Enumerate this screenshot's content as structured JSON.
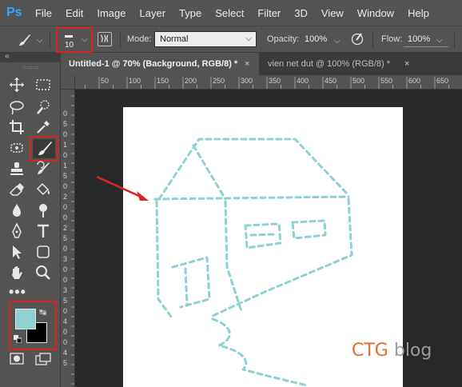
{
  "app": {
    "logo": "Ps",
    "accent_color": "#31a8ff"
  },
  "menu": [
    "File",
    "Edit",
    "Image",
    "Layer",
    "Type",
    "Select",
    "Filter",
    "3D",
    "View",
    "Window",
    "Help"
  ],
  "options_bar": {
    "tool_preset_icon": "brush-icon",
    "brush_size": "10",
    "mode_label": "Mode:",
    "mode_value": "Normal",
    "opacity_label": "Opacity:",
    "opacity_value": "100%",
    "flow_label": "Flow:",
    "flow_value": "100%"
  },
  "tabs": [
    {
      "label": "Untitled-1 @ 70% (Background, RGB/8) *",
      "active": true,
      "close": "×"
    },
    {
      "label": "vien net dut @ 100% (RGB/8) *",
      "active": false,
      "close": "×"
    }
  ],
  "ruler": {
    "top_labels": [
      "50",
      "100",
      "150",
      "200",
      "250",
      "300",
      "350",
      "400",
      "450",
      "500",
      "550",
      "600",
      "650"
    ],
    "left_labels": [
      "0",
      "5",
      "0",
      "1",
      "0",
      "1",
      "5",
      "0",
      "2",
      "0",
      "0",
      "2",
      "5",
      "0",
      "3",
      "0",
      "0",
      "3",
      "5",
      "0",
      "4",
      "0",
      "0",
      "4",
      "5"
    ]
  },
  "tools": {
    "active_tool": "brush-icon",
    "foreground_color": "#8fd1d2",
    "background_color": "#000000",
    "more_label": "•••"
  },
  "canvas": {
    "stroke_color": "#8fd1d2",
    "background": "#ffffff"
  },
  "annotation": {
    "color": "#d9231f"
  },
  "watermark": {
    "brand": "CTG",
    "word": "blog"
  }
}
